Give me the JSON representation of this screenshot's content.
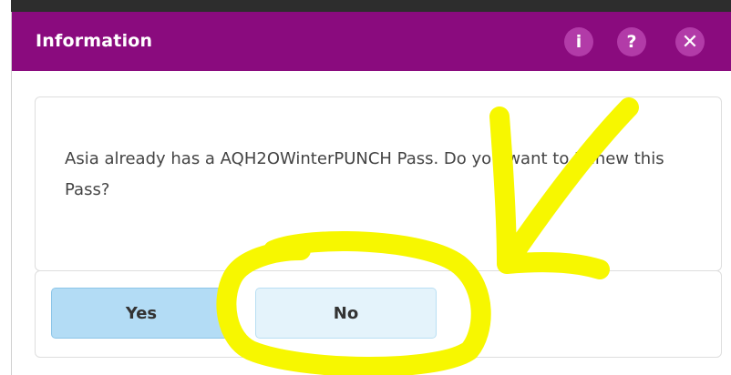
{
  "dialog": {
    "title": "Information",
    "buttons": {
      "info": "i",
      "help": "?",
      "close": "✕"
    },
    "message": "Asia already has a AQH2OWinterPUNCH Pass. Do you want to Renew this Pass?",
    "actions": {
      "yes_label": "Yes",
      "no_label": "No"
    }
  },
  "colors": {
    "titlebar": "#8a0b7e",
    "titlebar_button": "#b23ba8",
    "yes_button": "#b3dcf5",
    "no_button": "#e4f3fb",
    "annotation": "#f7f700"
  },
  "annotation": {
    "highlight_target": "No",
    "arrow_icon": "arrow-icon"
  }
}
